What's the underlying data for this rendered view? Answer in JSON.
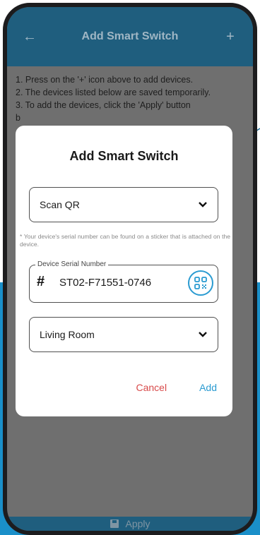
{
  "appbar": {
    "back_icon": "arrow-left-icon",
    "title": "Add Smart Switch",
    "add_icon": "plus-icon"
  },
  "instructions": {
    "line1": "1. Press on the '+' icon above to add devices.",
    "line2": "2. The devices listed below are saved temporarily.",
    "line3": "3. To add the devices, click the 'Apply' button",
    "line4": "b"
  },
  "bottom_bar": {
    "icon": "save-icon",
    "label": "Apply"
  },
  "dialog": {
    "title": "Add Smart Switch",
    "method_select": {
      "value": "Scan QR"
    },
    "hint": "* Your device's serial number can be found on a sticker that is attached on the device.",
    "serial_field": {
      "label": "Device Serial Number",
      "value": "ST02-F71551-0746"
    },
    "room_select": {
      "value": "Living Room"
    },
    "cancel_label": "Cancel",
    "add_label": "Add"
  },
  "colors": {
    "appbar": "#1f5e7e",
    "accent": "#2a9bd1",
    "cancel": "#d84a4a",
    "overlay": "#6f6f6f"
  }
}
